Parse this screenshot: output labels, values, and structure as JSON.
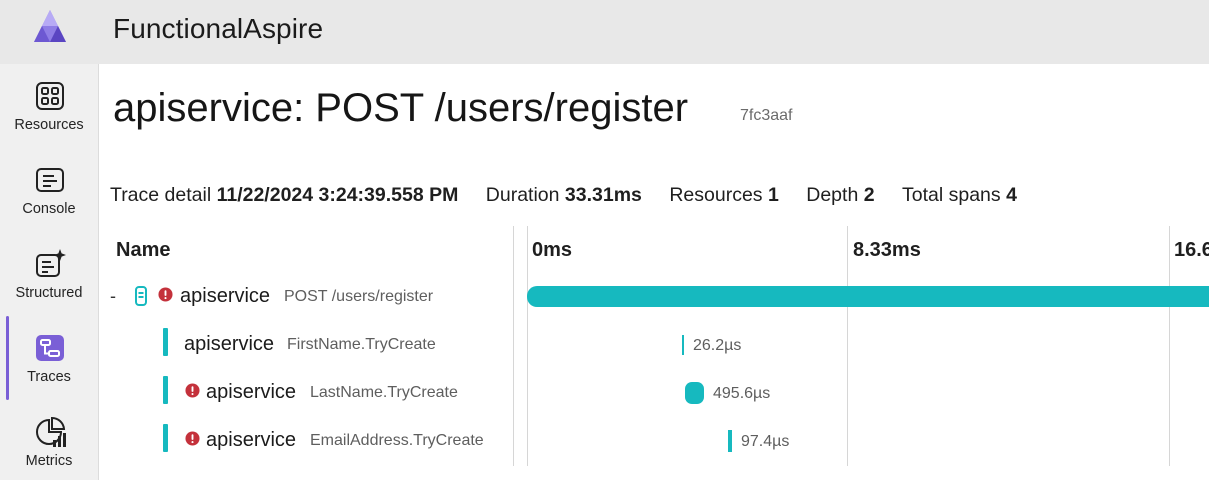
{
  "app": {
    "title": "FunctionalAspire",
    "logo_icon": "aspire-logo-icon"
  },
  "nav": {
    "items": [
      {
        "label": "Resources",
        "icon": "grid-icon",
        "active": false
      },
      {
        "label": "Console",
        "icon": "console-icon",
        "active": false
      },
      {
        "label": "Structured",
        "icon": "structured-logs-icon",
        "active": false
      },
      {
        "label": "Traces",
        "icon": "traces-icon",
        "active": true
      },
      {
        "label": "Metrics",
        "icon": "metrics-icon",
        "active": false
      }
    ]
  },
  "page": {
    "title": "apiservice: POST /users/register",
    "trace_id": "7fc3aaf"
  },
  "summary": {
    "trace_detail_label": "Trace detail",
    "trace_detail_value": "11/22/2024 3:24:39.558 PM",
    "duration_label": "Duration",
    "duration_value": "33.31ms",
    "resources_label": "Resources",
    "resources_value": "1",
    "depth_label": "Depth",
    "depth_value": "2",
    "total_spans_label": "Total spans",
    "total_spans_value": "4"
  },
  "table": {
    "name_header": "Name",
    "ticks": [
      "0ms",
      "8.33ms",
      "16.6"
    ]
  },
  "spans": [
    {
      "collapse": "-",
      "service": "apiservice",
      "operation": "POST /users/register",
      "error": true,
      "duration": ""
    },
    {
      "service": "apiservice",
      "operation": "FirstName.TryCreate",
      "error": false,
      "duration": "26.2µs"
    },
    {
      "service": "apiservice",
      "operation": "LastName.TryCreate",
      "error": true,
      "duration": "495.6µs"
    },
    {
      "service": "apiservice",
      "operation": "EmailAddress.TryCreate",
      "error": true,
      "duration": "97.4µs"
    }
  ],
  "colors": {
    "accent": "#7a5fd6",
    "span_bar": "#16b9bf",
    "error": "#c4313b"
  }
}
